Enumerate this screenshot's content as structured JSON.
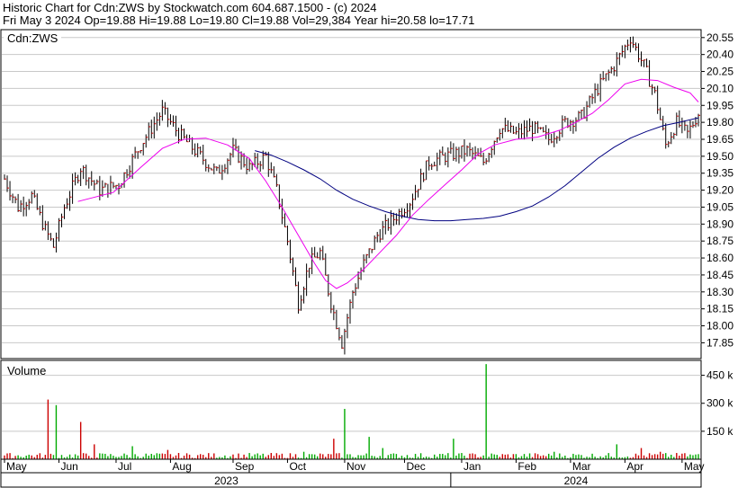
{
  "header": {
    "line1": "Historic Chart for Cdn:ZWS by Stockwatch.com 604.687.1500 - (c) 2024",
    "line2": "Fri May  3 2024  Op=19.88  Hi=19.88  Lo=19.80  Cl=19.88  Vol=29,384  Year hi=20.58  lo=17.71"
  },
  "symbol_label": "Cdn:ZWS",
  "volume_label": "Volume",
  "colors": {
    "background": "#ffffff",
    "frame": "#000000",
    "grid": "#c8c8c8",
    "price_bar": "#000000",
    "close_tick": "#cc0000",
    "ma_short": "#ee00ee",
    "ma_long": "#000080",
    "vol_up": "#00aa00",
    "vol_down": "#cc0000"
  },
  "chart_data": {
    "type": "ohlc",
    "price_axis": {
      "ticks": [
        17.85,
        18.0,
        18.15,
        18.3,
        18.45,
        18.6,
        18.75,
        18.9,
        19.05,
        19.2,
        19.35,
        19.5,
        19.65,
        19.8,
        19.95,
        20.1,
        20.25,
        20.4,
        20.55
      ],
      "ylim": [
        17.71,
        20.62
      ]
    },
    "volume_axis": {
      "ticks": [
        150000,
        300000,
        450000
      ],
      "tick_labels": [
        "150 k",
        "300 k",
        "450 k"
      ],
      "ylim": [
        0,
        530000
      ]
    },
    "months": [
      "May",
      "Jun",
      "Jul",
      "Aug",
      "Sep",
      "Oct",
      "Nov",
      "Dec",
      "Jan",
      "Feb",
      "Mar",
      "Apr",
      "May"
    ],
    "years": [
      "2023",
      "2024"
    ],
    "n_days": 256,
    "year_boundary_day": 164,
    "price_anchors": [
      [
        0,
        19.3
      ],
      [
        5,
        19.05
      ],
      [
        10,
        19.15
      ],
      [
        15,
        18.85
      ],
      [
        18,
        18.7
      ],
      [
        22,
        19.05
      ],
      [
        28,
        19.4
      ],
      [
        35,
        19.2
      ],
      [
        42,
        19.25
      ],
      [
        50,
        19.6
      ],
      [
        58,
        19.9
      ],
      [
        64,
        19.7
      ],
      [
        70,
        19.55
      ],
      [
        78,
        19.35
      ],
      [
        84,
        19.55
      ],
      [
        90,
        19.4
      ],
      [
        96,
        19.5
      ],
      [
        100,
        19.2
      ],
      [
        104,
        18.75
      ],
      [
        108,
        18.2
      ],
      [
        112,
        18.55
      ],
      [
        116,
        18.65
      ],
      [
        120,
        18.2
      ],
      [
        124,
        17.85
      ],
      [
        128,
        18.3
      ],
      [
        132,
        18.55
      ],
      [
        137,
        18.8
      ],
      [
        143,
        18.95
      ],
      [
        149,
        19.1
      ],
      [
        156,
        19.45
      ],
      [
        162,
        19.5
      ],
      [
        170,
        19.55
      ],
      [
        176,
        19.45
      ],
      [
        182,
        19.75
      ],
      [
        188,
        19.7
      ],
      [
        194,
        19.75
      ],
      [
        200,
        19.65
      ],
      [
        206,
        19.8
      ],
      [
        212,
        19.85
      ],
      [
        218,
        20.1
      ],
      [
        224,
        20.3
      ],
      [
        230,
        20.55
      ],
      [
        235,
        20.3
      ],
      [
        239,
        20.05
      ],
      [
        243,
        19.6
      ],
      [
        247,
        19.8
      ],
      [
        251,
        19.7
      ],
      [
        255,
        19.88
      ]
    ],
    "ma_short": [
      [
        27,
        19.1
      ],
      [
        40,
        19.18
      ],
      [
        50,
        19.4
      ],
      [
        58,
        19.57
      ],
      [
        66,
        19.65
      ],
      [
        74,
        19.66
      ],
      [
        82,
        19.6
      ],
      [
        90,
        19.48
      ],
      [
        96,
        19.28
      ],
      [
        102,
        19.05
      ],
      [
        108,
        18.8
      ],
      [
        114,
        18.55
      ],
      [
        118,
        18.4
      ],
      [
        122,
        18.33
      ],
      [
        126,
        18.38
      ],
      [
        132,
        18.5
      ],
      [
        138,
        18.65
      ],
      [
        144,
        18.8
      ],
      [
        150,
        18.98
      ],
      [
        156,
        19.12
      ],
      [
        162,
        19.25
      ],
      [
        168,
        19.38
      ],
      [
        174,
        19.52
      ],
      [
        180,
        19.6
      ],
      [
        188,
        19.65
      ],
      [
        196,
        19.67
      ],
      [
        204,
        19.73
      ],
      [
        210,
        19.8
      ],
      [
        216,
        19.88
      ],
      [
        222,
        20.0
      ],
      [
        228,
        20.14
      ],
      [
        234,
        20.18
      ],
      [
        240,
        20.17
      ],
      [
        246,
        20.11
      ],
      [
        252,
        20.06
      ],
      [
        255,
        19.98
      ]
    ],
    "ma_long": [
      [
        92,
        19.55
      ],
      [
        98,
        19.51
      ],
      [
        104,
        19.45
      ],
      [
        110,
        19.38
      ],
      [
        116,
        19.3
      ],
      [
        122,
        19.2
      ],
      [
        128,
        19.12
      ],
      [
        134,
        19.06
      ],
      [
        140,
        19.01
      ],
      [
        146,
        18.97
      ],
      [
        152,
        18.94
      ],
      [
        158,
        18.93
      ],
      [
        164,
        18.93
      ],
      [
        170,
        18.94
      ],
      [
        176,
        18.95
      ],
      [
        182,
        18.97
      ],
      [
        188,
        19.01
      ],
      [
        194,
        19.06
      ],
      [
        200,
        19.14
      ],
      [
        206,
        19.24
      ],
      [
        212,
        19.36
      ],
      [
        218,
        19.48
      ],
      [
        224,
        19.58
      ],
      [
        230,
        19.66
      ],
      [
        236,
        19.72
      ],
      [
        242,
        19.77
      ],
      [
        248,
        19.8
      ],
      [
        255,
        19.84
      ]
    ],
    "volume_spikes": [
      [
        16,
        320000
      ],
      [
        19,
        290000
      ],
      [
        28,
        200000
      ],
      [
        33,
        80000
      ],
      [
        47,
        70000
      ],
      [
        60,
        50000
      ],
      [
        110,
        40000
      ],
      [
        121,
        110000
      ],
      [
        125,
        270000
      ],
      [
        134,
        120000
      ],
      [
        139,
        60000
      ],
      [
        165,
        110000
      ],
      [
        177,
        510000
      ],
      [
        202,
        40000
      ],
      [
        225,
        80000
      ],
      [
        234,
        60000
      ],
      [
        241,
        40000
      ],
      [
        249,
        30000
      ]
    ]
  }
}
